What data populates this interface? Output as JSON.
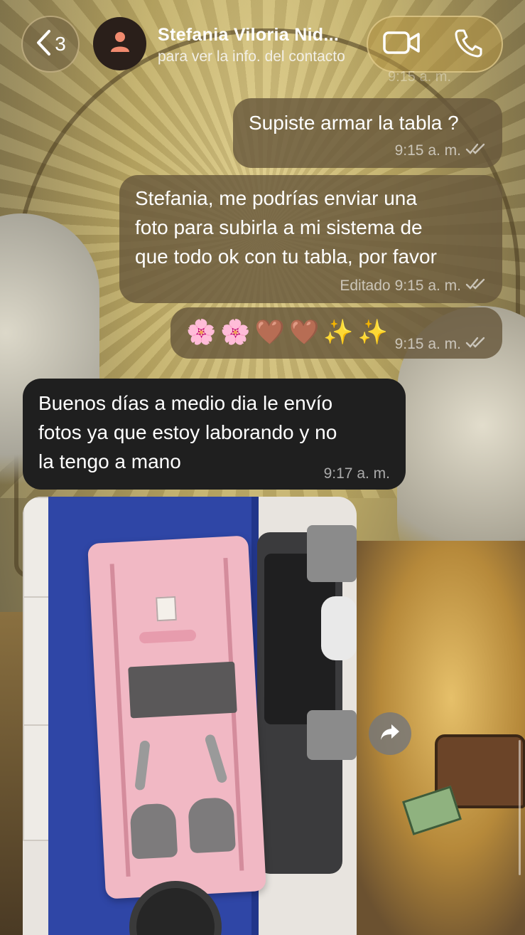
{
  "header": {
    "back_count": "3",
    "contact_name": "Stefania Viloria Nid...",
    "contact_subtitle": "para ver la info. del contacto",
    "ghost_time": "9:15 a. m."
  },
  "messages": [
    {
      "direction": "outgoing",
      "text": "Supiste armar la tabla ?",
      "time": "9:15 a. m.",
      "status": "read"
    },
    {
      "direction": "outgoing",
      "lines": [
        "Stefania, me podrías enviar una",
        "foto para subirla a mi sistema de",
        "que todo ok con tu tabla, por favor"
      ],
      "edited_label": "Editado",
      "time": "9:15 a. m.",
      "status": "read"
    },
    {
      "direction": "outgoing",
      "emojis": [
        "🌸",
        "🌸",
        "🤎",
        "🤎",
        "✨",
        "✨"
      ],
      "time": "9:15 a. m.",
      "status": "read"
    },
    {
      "direction": "incoming",
      "lines": [
        "Buenos días a medio dia le envío",
        "fotos ya que estoy laborando y no",
        "la tengo a mano"
      ],
      "time": "9:17 a. m."
    },
    {
      "direction": "incoming",
      "type": "photo"
    }
  ],
  "icons": {
    "back": "chevron-left-icon",
    "avatar": "person-icon",
    "video": "video-camera-icon",
    "phone": "phone-icon",
    "read_receipt": "double-check-icon",
    "forward": "forward-arrow-icon"
  },
  "colors": {
    "outgoing_bubble": "#68583c",
    "incoming_bubble": "#1f1f1f",
    "avatar_icon": "#f08a6e"
  }
}
